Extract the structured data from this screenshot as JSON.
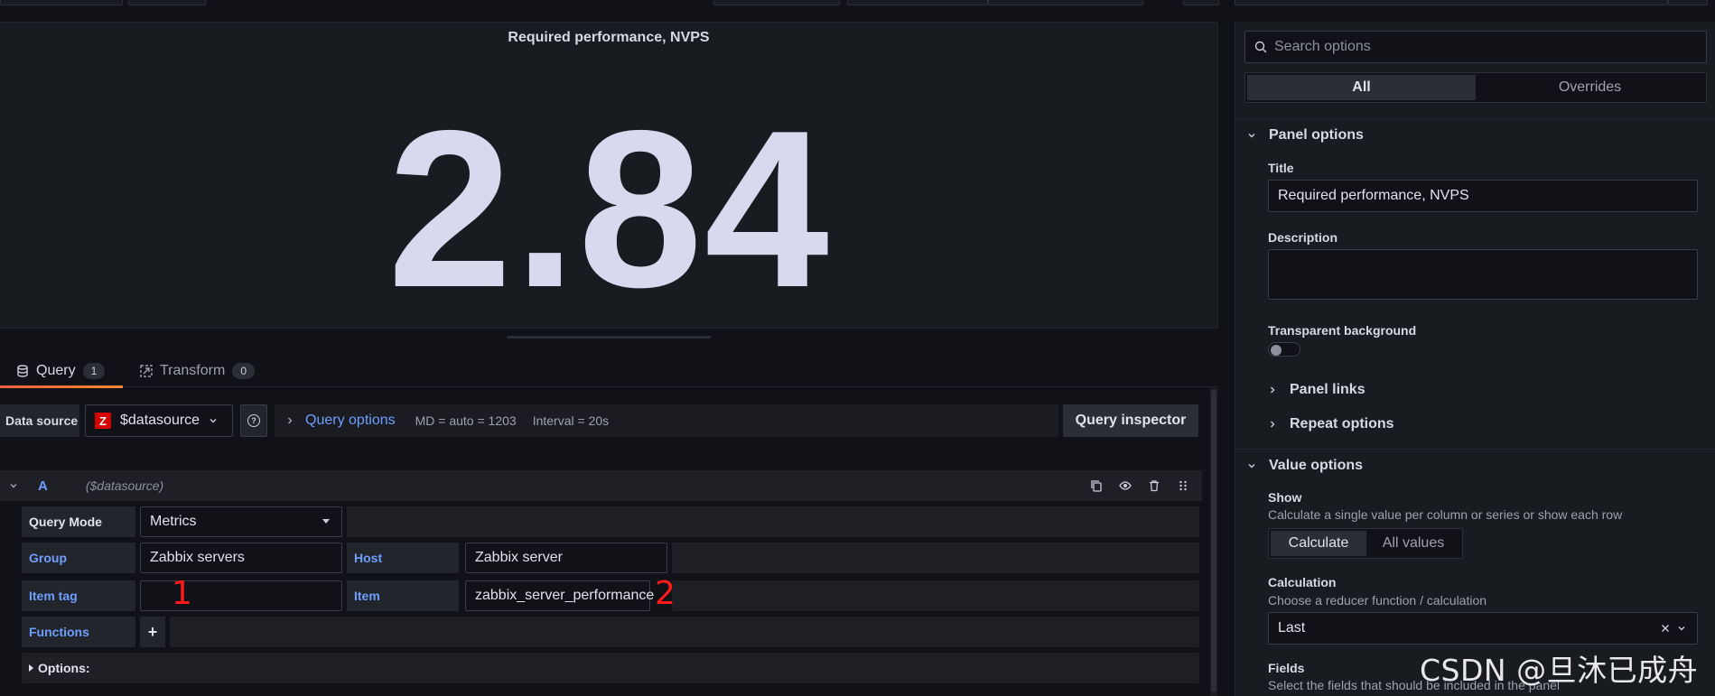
{
  "panel": {
    "title": "Required performance, NVPS",
    "value": "2.84"
  },
  "tabs": [
    {
      "label": "Query",
      "count": "1",
      "active": true
    },
    {
      "label": "Transform",
      "count": "0",
      "active": false
    }
  ],
  "query_toolbar": {
    "datasource_label": "Data source",
    "datasource_value": "$datasource",
    "query_options_label": "Query options",
    "md_text": "MD = auto = 1203",
    "interval_text": "Interval = 20s",
    "inspector_label": "Query inspector"
  },
  "query_row": {
    "ref_id": "A",
    "datasource": "($datasource)",
    "query_mode_label": "Query Mode",
    "query_mode_value": "Metrics",
    "group_label": "Group",
    "group_value": "Zabbix servers",
    "host_label": "Host",
    "host_value": "Zabbix server",
    "item_tag_label": "Item tag",
    "item_tag_value": "",
    "item_label": "Item",
    "item_value": "zabbix_server_performance",
    "functions_label": "Functions",
    "add_symbol": "+",
    "options_label": "Options:"
  },
  "annotations": {
    "mark1": "1",
    "mark2": "2"
  },
  "options_pane": {
    "search_placeholder": "Search options",
    "seg_all": "All",
    "seg_overrides": "Overrides",
    "panel_options": {
      "header": "Panel options",
      "title_label": "Title",
      "title_value": "Required performance, NVPS",
      "description_label": "Description",
      "transparent_label": "Transparent background",
      "panel_links": "Panel links",
      "repeat_options": "Repeat options"
    },
    "value_options": {
      "header": "Value options",
      "show_label": "Show",
      "show_desc": "Calculate a single value per column or series or show each row",
      "show_calculate": "Calculate",
      "show_all_values": "All values",
      "calculation_label": "Calculation",
      "calculation_desc": "Choose a reducer function / calculation",
      "calculation_value": "Last",
      "fields_label": "Fields",
      "fields_desc": "Select the fields that should be included in the panel"
    }
  },
  "watermark": "CSDN @旦沐已成舟",
  "colors": {
    "accent_blue": "#6e9fff",
    "tab_underline": "#f55f3e",
    "zabbix_red": "#d40000",
    "annotation_red": "#ff1a1a"
  }
}
